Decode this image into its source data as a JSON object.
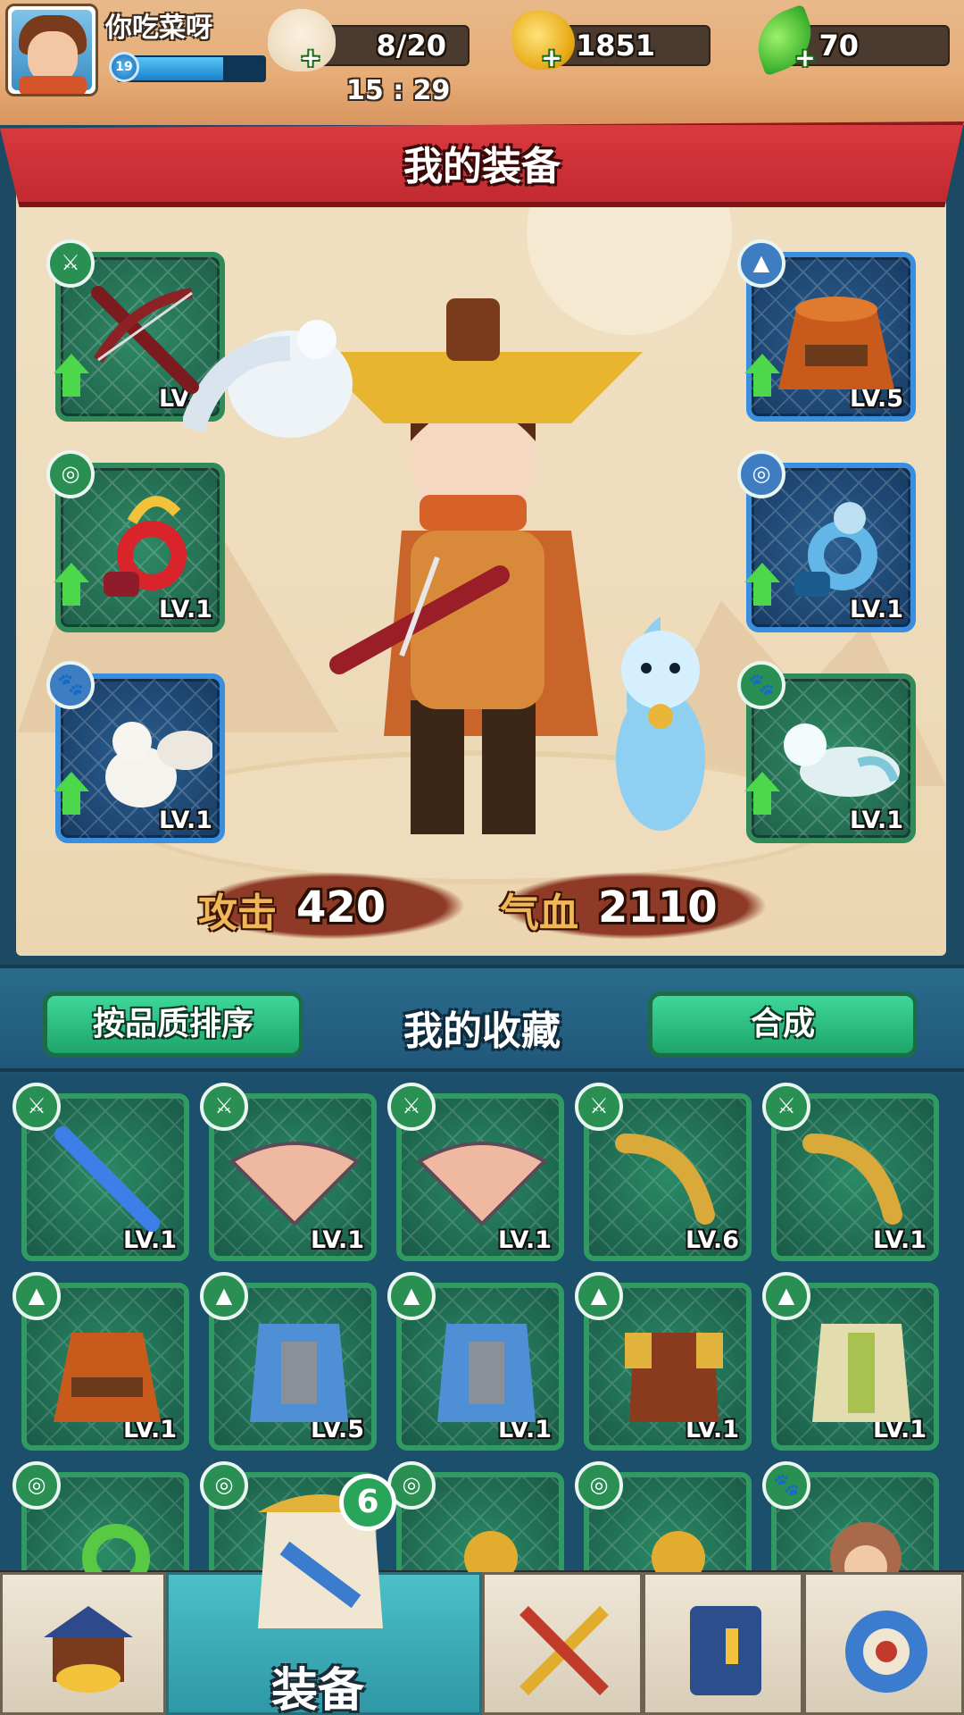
{
  "player": {
    "name": "你吃菜呀",
    "level": "19",
    "xp_fraction": 0.72
  },
  "resources": {
    "energy": "8/20",
    "gold": "1851",
    "leaf": "70",
    "timer": "15 : 29"
  },
  "equip_panel": {
    "title": "我的装备",
    "left_slots": [
      {
        "type": "weapon",
        "level": "LV.5"
      },
      {
        "type": "accessory",
        "level": "LV.1"
      },
      {
        "type": "pet",
        "level": "LV.1"
      }
    ],
    "right_slots": [
      {
        "type": "armor",
        "level": "LV.5"
      },
      {
        "type": "accessory",
        "level": "LV.1"
      },
      {
        "type": "pet",
        "level": "LV.1"
      }
    ]
  },
  "stats": {
    "attack_label": "攻击",
    "attack": "420",
    "hp_label": "气血",
    "hp": "2110"
  },
  "collection": {
    "title": "我的收藏",
    "sort_button": "按品质排序",
    "merge_button": "合成",
    "row1": [
      "LV.1",
      "LV.1",
      "LV.1",
      "LV.6",
      "LV.1"
    ],
    "row2": [
      "LV.1",
      "LV.5",
      "LV.1",
      "LV.1",
      "LV.1"
    ]
  },
  "nav": {
    "active_label": "装备",
    "badge_count": "6"
  },
  "colors": {
    "banner": "#c22a30",
    "accent_green": "#2f9a62",
    "panel": "#eedcbd"
  }
}
